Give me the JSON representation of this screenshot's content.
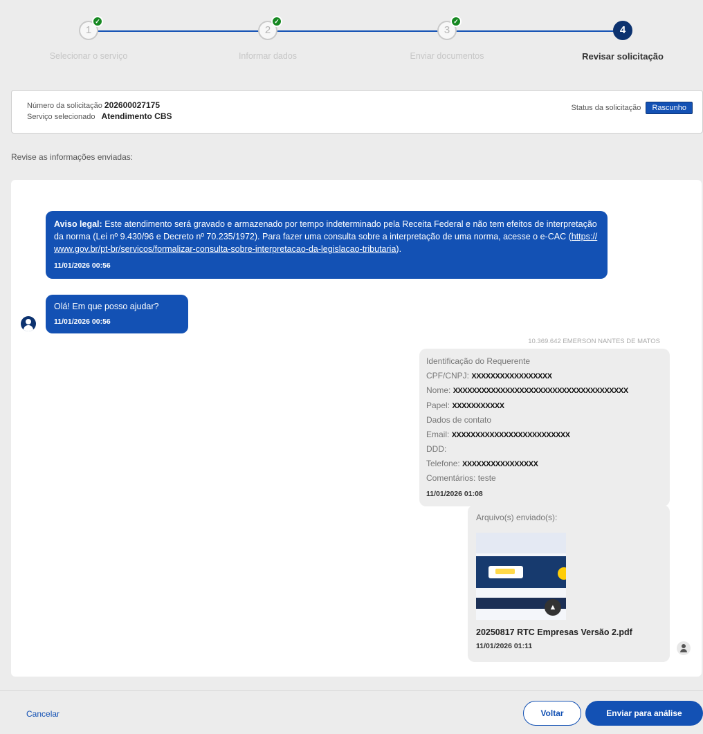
{
  "stepper": {
    "steps": [
      {
        "number": "1",
        "label": "Selecionar o serviço",
        "completed": true
      },
      {
        "number": "2",
        "label": "Informar dados",
        "completed": true
      },
      {
        "number": "3",
        "label": "Enviar documentos",
        "completed": true
      },
      {
        "number": "4",
        "label": "Revisar solicitação",
        "active": true
      }
    ]
  },
  "request": {
    "number_label": "Número da solicitação",
    "number": "202600027175",
    "service_label": "Serviço selecionado",
    "service": "Atendimento CBS",
    "status_label": "Status da solicitação",
    "status": "Rascunho"
  },
  "review_title": "Revise as informações enviadas:",
  "chat": {
    "legal": {
      "lead": "Aviso legal:",
      "text": "Este atendimento será gravado e armazenado por tempo indeterminado pela Receita Federal e não tem efeitos de interpretação da norma (Lei nº 9.430/96 e Decreto nº 70.235/1972). Para fazer uma consulta sobre a interpretação de uma norma, acesse o e-CAC (",
      "link": "https://www.gov.br/pt-br/servicos/formalizar-consulta-sobre-interpretacao-da-legislacao-tributaria",
      "tail": ").",
      "time": "11/01/2026 00:56"
    },
    "greeting": {
      "text": "Olá! Em que posso ajudar?",
      "time": "11/01/2026 00:56"
    },
    "sender": "10.369.642 EMERSON NANTES DE MATOS",
    "requester": {
      "title": "Identificação do Requerente",
      "cpf_label": "CPF/CNPJ:",
      "cpf_value": "XXXXXXXXXXXXXXXXX",
      "name_label": "Nome:",
      "name_value": "XXXXXXXXXXXXXXXXXXXXXXXXXXXXXXXXXXXXX",
      "role_label": "Papel:",
      "role_value": "XXXXXXXXXXX",
      "contact_title": "Dados de contato",
      "email_label": "Email:",
      "email_value": "XXXXXXXXXXXXXXXXXXXXXXXXX",
      "ddd_label": "DDD:",
      "phone_label": "Telefone:",
      "phone_value": "XXXXXXXXXXXXXXXX",
      "comments": "Comentários: teste",
      "time": "11/01/2026 01:08"
    },
    "files": {
      "title": "Arquivo(s) enviado(s):",
      "file_name": "20250817 RTC Empresas Versão 2.pdf",
      "time": "11/01/2026 01:11"
    }
  },
  "footer": {
    "cancel": "Cancelar",
    "back": "Voltar",
    "submit": "Enviar para análise"
  },
  "icons": {
    "check": "check-icon",
    "bot_avatar": "bot-avatar-icon",
    "user": "user-icon",
    "drive": "drive-icon"
  },
  "colors": {
    "primary": "#1351b4",
    "primary_dark": "#0c326f",
    "success": "#168821"
  }
}
